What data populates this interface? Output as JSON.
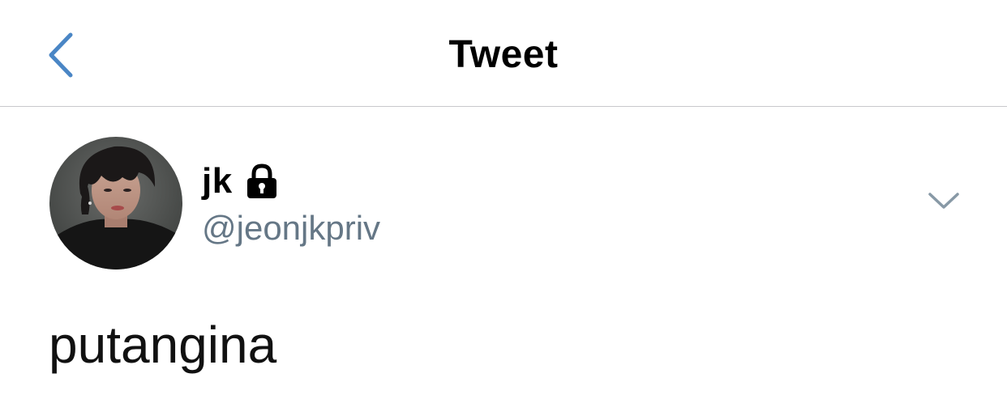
{
  "header": {
    "title": "Tweet",
    "back_icon": "chevron-left-icon",
    "accent_color": "#4a86c5"
  },
  "tweet": {
    "author": {
      "display_name": "jk",
      "handle": "@jeonjkpriv",
      "protected_icon": "lock-icon",
      "avatar": "profile-photo"
    },
    "menu_icon": "chevron-down-icon",
    "text": "putangina"
  },
  "colors": {
    "handle": "#657786",
    "divider": "#c8c8cc",
    "caret": "#8899a6"
  }
}
